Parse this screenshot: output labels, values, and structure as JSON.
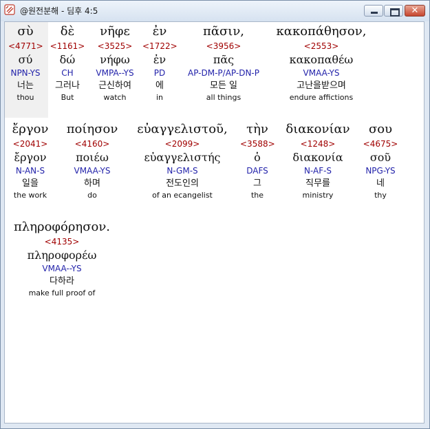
{
  "window": {
    "title": "@원전분해 - 딤후 4:5"
  },
  "rows": [
    [
      {
        "greek": "σὺ",
        "strong": "<4771>",
        "lemma": "σύ",
        "parse": "NPN-YS",
        "korean": "너는",
        "english": "thou"
      },
      {
        "greek": "δὲ",
        "strong": "<1161>",
        "lemma": "δώ",
        "parse": "CH",
        "korean": "그러나",
        "english": "But"
      },
      {
        "greek": "νῆφε",
        "strong": "<3525>",
        "lemma": "νήφω",
        "parse": "VMPA--YS",
        "korean": "근신하여",
        "english": "watch"
      },
      {
        "greek": "ἐν",
        "strong": "<1722>",
        "lemma": "ἐν",
        "parse": "PD",
        "korean": "에",
        "english": "in"
      },
      {
        "greek": "πᾶσιν,",
        "strong": "<3956>",
        "lemma": "πᾶς",
        "parse": "AP-DM-P/AP-DN-P",
        "korean": "모든 일",
        "english": "all things"
      },
      {
        "greek": "κακοπάθησον,",
        "strong": "<2553>",
        "lemma": "κακοπαθέω",
        "parse": "VMAA-YS",
        "korean": "고난을받으며",
        "english": "endure affictions"
      }
    ],
    [
      {
        "greek": "ἔργον",
        "strong": "<2041>",
        "lemma": "ἔργον",
        "parse": "N-AN-S",
        "korean": "일을",
        "english": "the work"
      },
      {
        "greek": "ποίησον",
        "strong": "<4160>",
        "lemma": "ποιέω",
        "parse": "VMAA-YS",
        "korean": "하며",
        "english": "do"
      },
      {
        "greek": "εὐαγγελιστοῦ,",
        "strong": "<2099>",
        "lemma": "εὐαγγελιστής",
        "parse": "N-GM-S",
        "korean": "전도인의",
        "english": "of an ecangelist"
      },
      {
        "greek": "τὴν",
        "strong": "<3588>",
        "lemma": "ὁ",
        "parse": "DAFS",
        "korean": "그",
        "english": "the"
      },
      {
        "greek": "διακονίαν",
        "strong": "<1248>",
        "lemma": "διακονία",
        "parse": "N-AF-S",
        "korean": "직무를",
        "english": "ministry"
      },
      {
        "greek": "σου",
        "strong": "<4675>",
        "lemma": "σοῦ",
        "parse": "NPG-YS",
        "korean": "네",
        "english": "thy"
      }
    ],
    [
      {
        "greek": "πληροφόρησον.",
        "strong": "<4135>",
        "lemma": "πληροφορέω",
        "parse": "VMAA--YS",
        "korean": "다하라",
        "english": "make full proof of"
      }
    ]
  ]
}
